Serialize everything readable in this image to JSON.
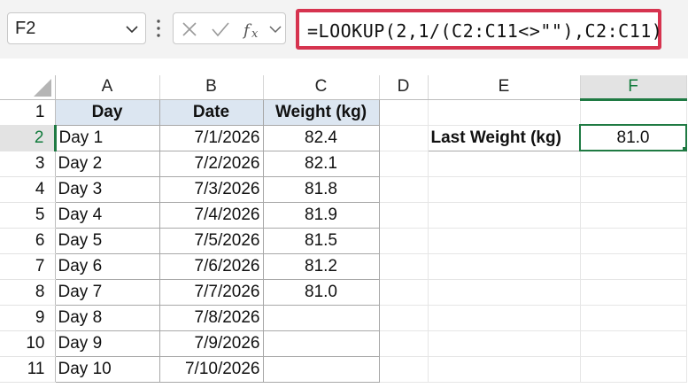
{
  "formula_bar": {
    "name_box": "F2",
    "formula": "=LOOKUP(2,1/(C2:C11<>\"\"),C2:C11)",
    "icons": [
      "chevron-down-icon",
      "more-options-icon",
      "cancel-icon",
      "enter-icon",
      "insert-function-icon",
      "expand-chevron-icon"
    ],
    "accent_color": "#d6334f"
  },
  "columns": [
    "A",
    "B",
    "C",
    "D",
    "E",
    "F"
  ],
  "selected_column": "F",
  "rows": [
    "1",
    "2",
    "3",
    "4",
    "5",
    "6",
    "7",
    "8",
    "9",
    "10",
    "11"
  ],
  "selected_row": "2",
  "table": {
    "headers": [
      "Day",
      "Date",
      "Weight (kg)"
    ],
    "records": [
      {
        "day": "Day 1",
        "date": "7/1/2026",
        "weight": "82.4"
      },
      {
        "day": "Day 2",
        "date": "7/2/2026",
        "weight": "82.1"
      },
      {
        "day": "Day 3",
        "date": "7/3/2026",
        "weight": "81.8"
      },
      {
        "day": "Day 4",
        "date": "7/4/2026",
        "weight": "81.9"
      },
      {
        "day": "Day 5",
        "date": "7/5/2026",
        "weight": "81.5"
      },
      {
        "day": "Day 6",
        "date": "7/6/2026",
        "weight": "81.2"
      },
      {
        "day": "Day 7",
        "date": "7/7/2026",
        "weight": "81.0"
      },
      {
        "day": "Day 8",
        "date": "7/8/2026",
        "weight": ""
      },
      {
        "day": "Day 9",
        "date": "7/9/2026",
        "weight": ""
      },
      {
        "day": "Day 10",
        "date": "7/10/2026",
        "weight": ""
      }
    ],
    "header_fill": "#dce6f1"
  },
  "result": {
    "label": "Last Weight (kg)",
    "value": "81.0"
  },
  "selection_color": "#1f7a43"
}
